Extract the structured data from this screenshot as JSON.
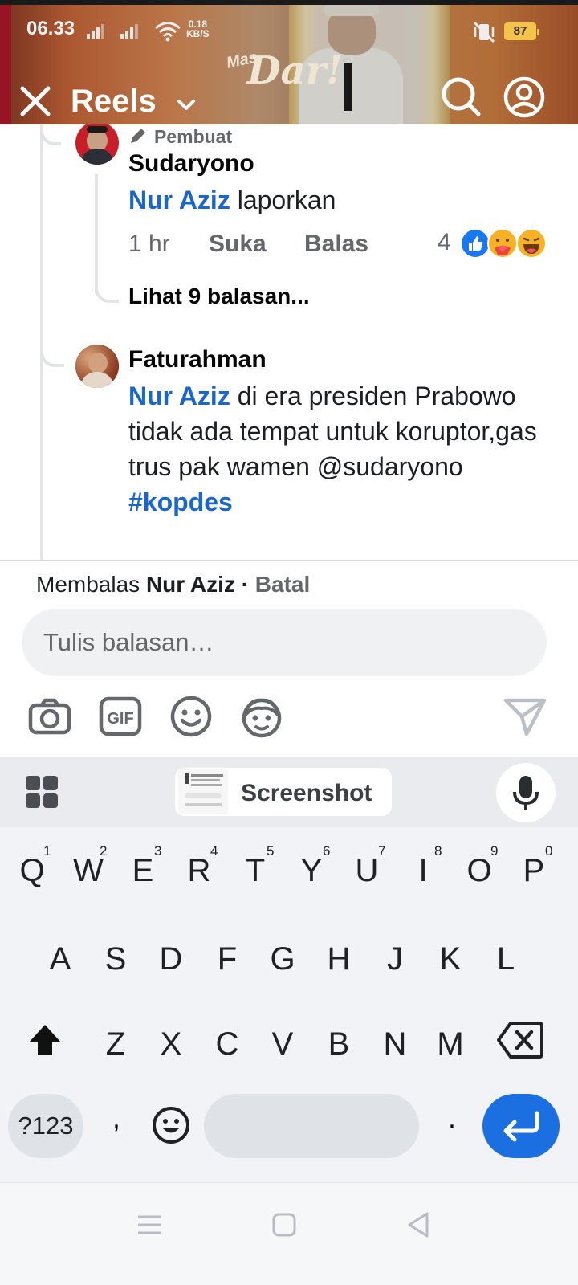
{
  "status_bar": {
    "time": "06.33",
    "net_speed_value": "0.18",
    "net_speed_unit": "KB/S",
    "battery": "87"
  },
  "header": {
    "watermark_small": "Mas",
    "watermark_large": "Dar!",
    "title": "Reels"
  },
  "comments": [
    {
      "badge_label": "Pembuat",
      "author": "Sudaryono",
      "mention": "Nur Aziz",
      "text": " laporkan",
      "time": "1 hr",
      "like_label": "Suka",
      "reply_label": "Balas",
      "reaction_count": "4",
      "reactions": [
        "like-icon",
        "care-icon",
        "haha-icon"
      ],
      "view_replies": "Lihat 9 balasan..."
    },
    {
      "author": "Faturahman",
      "mention": "Nur Aziz",
      "text": " di era presiden Prabowo tidak ada tempat untuk koruptor,gas trus pak wamen @sudaryono",
      "hashtag": "#kopdes"
    }
  ],
  "reply_bar": {
    "prefix": "Membalas ",
    "target": "Nur Aziz",
    "separator": " · ",
    "cancel": "Batal",
    "placeholder": "Tulis balasan…",
    "tools": [
      "camera-icon",
      "gif-icon",
      "emoji-icon",
      "avatar-sticker-icon",
      "send-icon"
    ]
  },
  "keyboard": {
    "clipboard_label": "Screenshot",
    "row1": [
      "Q",
      "W",
      "E",
      "R",
      "T",
      "Y",
      "U",
      "I",
      "O",
      "P"
    ],
    "row1_hints": [
      "1",
      "2",
      "3",
      "4",
      "5",
      "6",
      "7",
      "8",
      "9",
      "0"
    ],
    "row2": [
      "A",
      "S",
      "D",
      "F",
      "G",
      "H",
      "J",
      "K",
      "L"
    ],
    "row3": [
      "Z",
      "X",
      "C",
      "V",
      "B",
      "N",
      "M"
    ],
    "symbols_key": "?123",
    "comma_key": ",",
    "period_key": "."
  },
  "colors": {
    "link_blue": "#1a66cc",
    "enter_key": "#1b6fe0",
    "battery": "#f3c34a"
  }
}
